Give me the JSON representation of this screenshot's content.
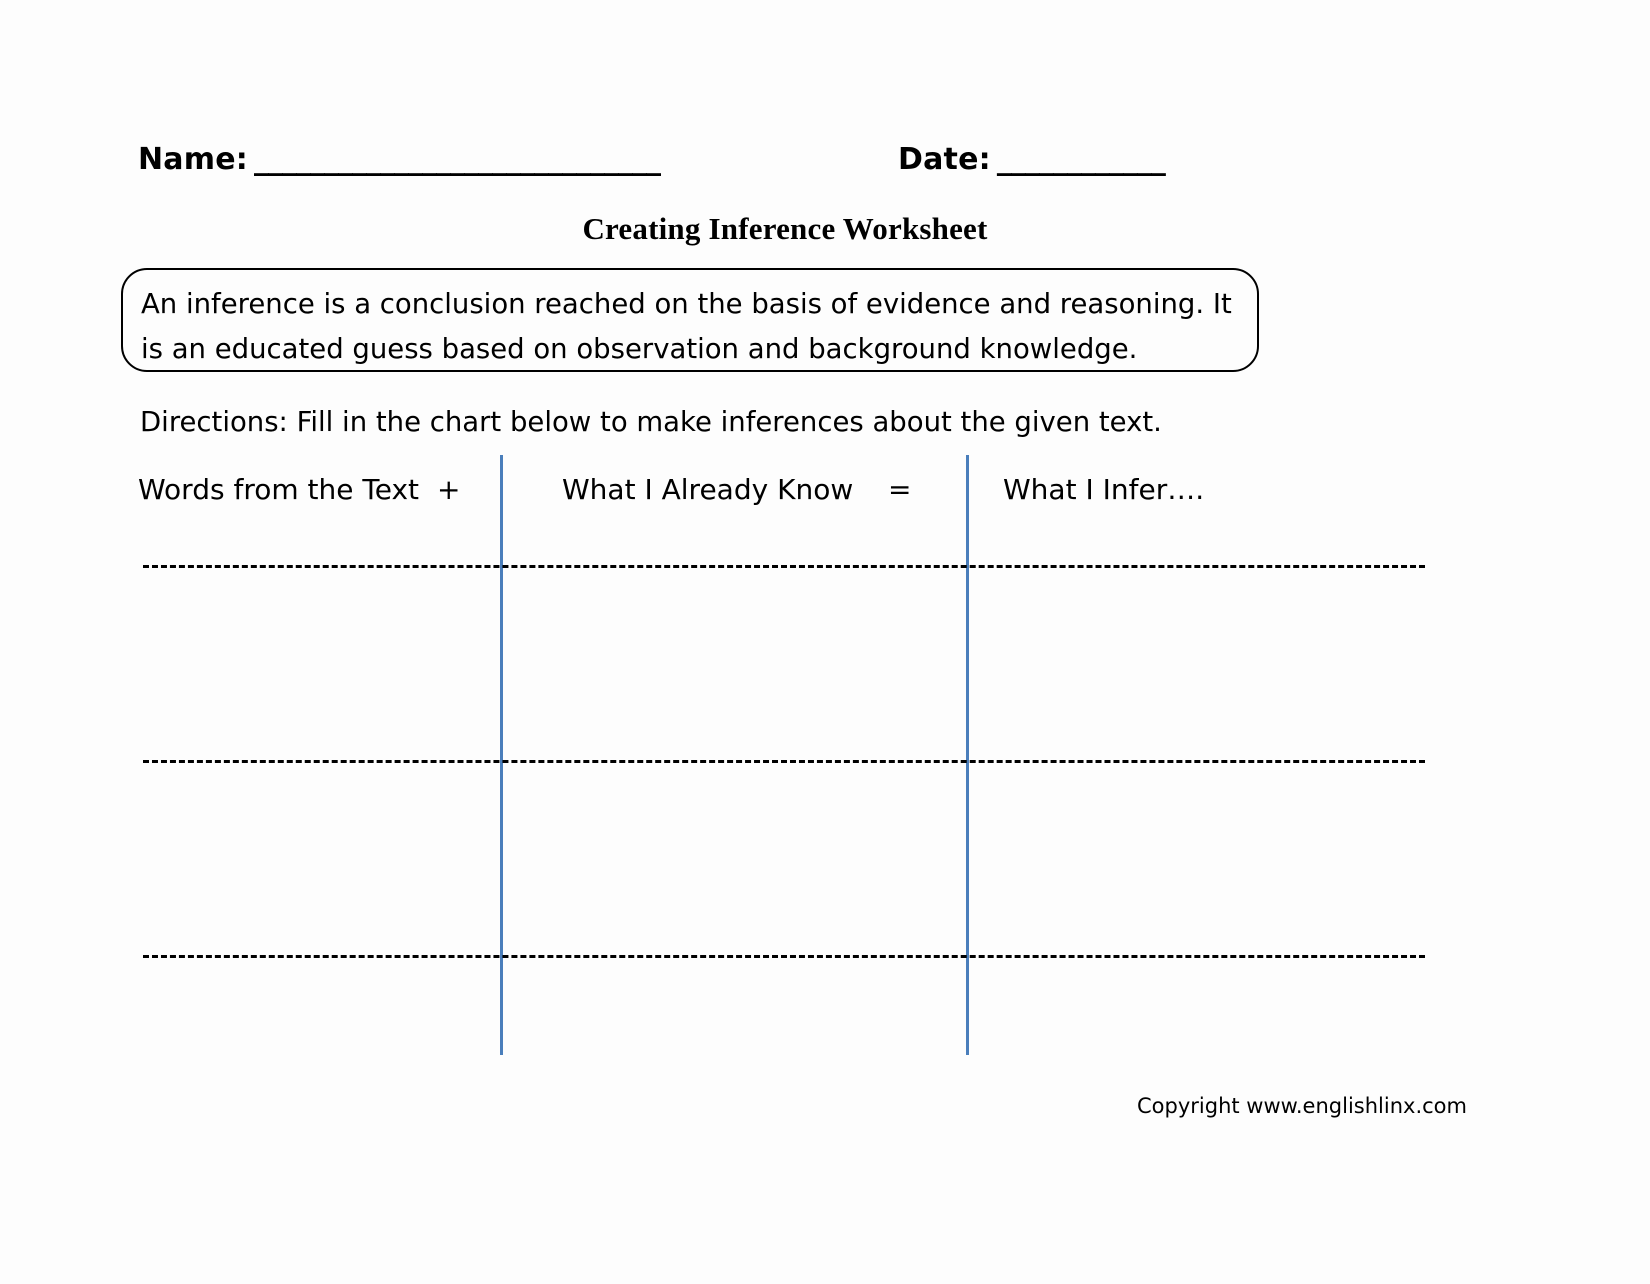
{
  "header": {
    "name_label": "Name:",
    "name_rule": "_____________________________",
    "date_label": "Date:",
    "date_rule": "____________"
  },
  "title": "Creating Inference Worksheet",
  "definition": {
    "text": "An inference is a conclusion reached on the basis of evidence and reasoning. It is an educated guess based on observation and background knowledge."
  },
  "directions": "Directions: Fill in the chart below to make inferences about the given text.",
  "chart_data": {
    "type": "table",
    "title": "Inference chart",
    "columns": [
      "Words from the Text",
      "What I Already Know",
      "What I Infer…."
    ],
    "operators": [
      "+",
      "="
    ],
    "rows": [
      [
        "",
        "",
        ""
      ],
      [
        "",
        "",
        ""
      ],
      [
        "",
        "",
        ""
      ]
    ],
    "row_count": 3,
    "grid": {
      "vertical_rule_color": "#4a7ebb",
      "horizontal_rule_style": "dashed",
      "horizontal_rule_color": "#000000"
    }
  },
  "footer": {
    "copyright": "Copyright www.englishlinx.com"
  },
  "colors": {
    "page_background": "#fdfdfd",
    "text": "#000000",
    "column_divider": "#4a7ebb"
  }
}
